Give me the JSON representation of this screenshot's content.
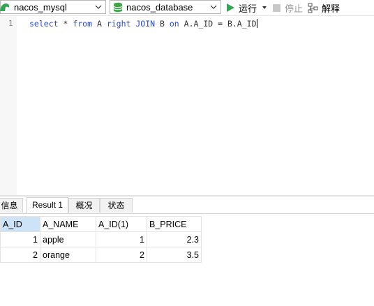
{
  "toolbar": {
    "connection": "nacos_mysql",
    "database": "nacos_database",
    "run_label": "运行",
    "stop_label": "停止",
    "explain_label": "解释"
  },
  "editor": {
    "line_number": "1",
    "sql_tokens": [
      "select",
      " * ",
      "from",
      " A ",
      "right",
      " ",
      "JOIN",
      " B ",
      "on",
      " A.A_ID = B.A_ID"
    ]
  },
  "tabs": [
    "信息",
    "Result 1",
    "概况",
    "状态"
  ],
  "result": {
    "columns": [
      "A_ID",
      "A_NAME",
      "A_ID(1)",
      "B_PRICE"
    ],
    "rows": [
      [
        "1",
        "apple",
        "1",
        "2.3"
      ],
      [
        "2",
        "orange",
        "2",
        "3.5"
      ]
    ]
  },
  "colors": {
    "keyword": "#2a48d8",
    "run_icon": "#2fa84f",
    "db_icon": "#3fa64a",
    "selected_header": "#cde3f7"
  }
}
